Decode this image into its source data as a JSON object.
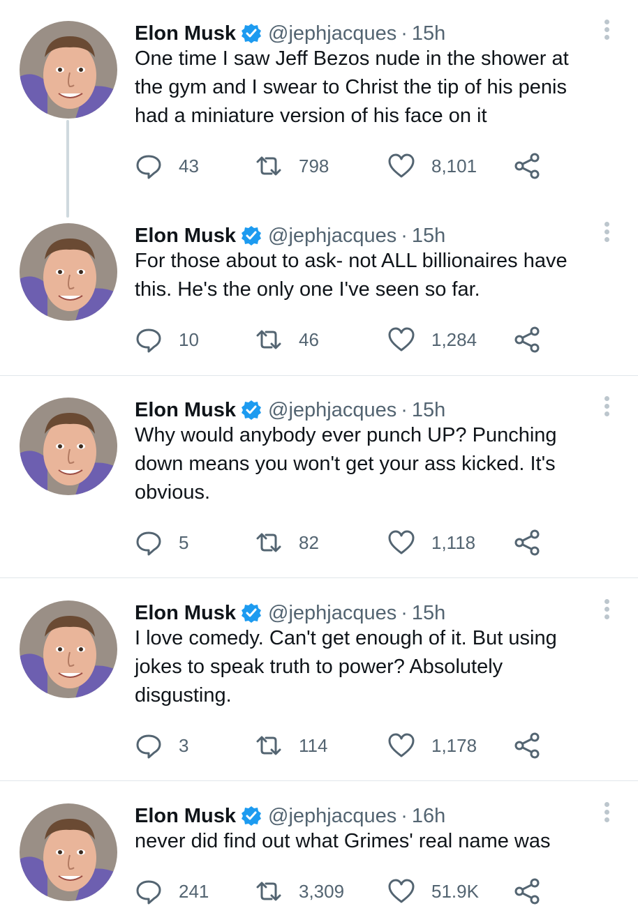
{
  "tweets": [
    {
      "name": "Elon Musk",
      "handle": "@jephjacques",
      "separator": "·",
      "time": "15h",
      "lines": [
        "One time I saw Jeff Bezos nude in the shower at",
        "the gym and I swear to Christ the tip of his penis",
        "had a miniature version of his face on it"
      ],
      "replies": "43",
      "retweets": "798",
      "likes": "8,101"
    },
    {
      "name": "Elon Musk",
      "handle": "@jephjacques",
      "separator": "·",
      "time": "15h",
      "lines": [
        "For those about to ask- not ALL billionaires have",
        "this. He's the only one I've seen so far."
      ],
      "replies": "10",
      "retweets": "46",
      "likes": "1,284"
    },
    {
      "name": "Elon Musk",
      "handle": "@jephjacques",
      "separator": "·",
      "time": "15h",
      "lines": [
        "Why would anybody ever punch UP? Punching",
        "down means you won't get your ass kicked. It's",
        "obvious."
      ],
      "replies": "5",
      "retweets": "82",
      "likes": "1,118"
    },
    {
      "name": "Elon Musk",
      "handle": "@jephjacques",
      "separator": "·",
      "time": "15h",
      "lines": [
        "I love comedy. Can't get enough of it. But using",
        "jokes to speak truth to power? Absolutely",
        "disgusting."
      ],
      "replies": "3",
      "retweets": "114",
      "likes": "1,178"
    },
    {
      "name": "Elon Musk",
      "handle": "@jephjacques",
      "separator": "·",
      "time": "16h",
      "lines": [
        "never did find out what Grimes' real name was"
      ],
      "replies": "241",
      "retweets": "3,309",
      "likes": "51.9K"
    }
  ],
  "icons": {
    "reply": "reply-icon",
    "retweet": "retweet-icon",
    "like": "heart-icon",
    "share": "share-icon",
    "verified": "verified-badge-icon",
    "more": "more-options-icon"
  },
  "colors": {
    "text": "#0f1419",
    "secondary": "#536471",
    "verified": "#1d9bf0",
    "divider": "#e1e6ea",
    "thread_line": "#cfd9de"
  }
}
